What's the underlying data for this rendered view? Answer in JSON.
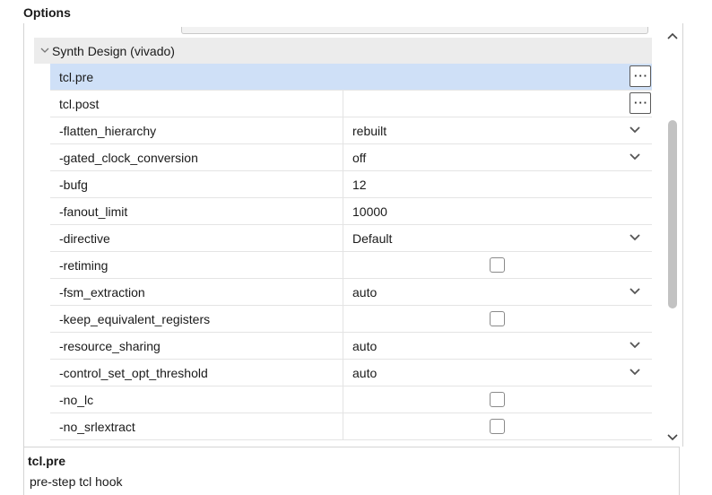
{
  "panel": {
    "title": "Options"
  },
  "group": {
    "label": "Synth Design (vivado)"
  },
  "rows": [
    {
      "name": "tcl.pre",
      "value": "",
      "control": "more",
      "selected": true
    },
    {
      "name": "tcl.post",
      "value": "",
      "control": "more"
    },
    {
      "name": "-flatten_hierarchy",
      "value": "rebuilt",
      "control": "dropdown"
    },
    {
      "name": "-gated_clock_conversion",
      "value": "off",
      "control": "dropdown"
    },
    {
      "name": "-bufg",
      "value": "12",
      "control": "text"
    },
    {
      "name": "-fanout_limit",
      "value": "10000",
      "control": "text"
    },
    {
      "name": "-directive",
      "value": "Default",
      "control": "dropdown"
    },
    {
      "name": "-retiming",
      "value": "",
      "control": "checkbox",
      "checked": false
    },
    {
      "name": "-fsm_extraction",
      "value": "auto",
      "control": "dropdown"
    },
    {
      "name": "-keep_equivalent_registers",
      "value": "",
      "control": "checkbox",
      "checked": false
    },
    {
      "name": "-resource_sharing",
      "value": "auto",
      "control": "dropdown"
    },
    {
      "name": "-control_set_opt_threshold",
      "value": "auto",
      "control": "dropdown"
    },
    {
      "name": "-no_lc",
      "value": "",
      "control": "checkbox",
      "checked": false
    },
    {
      "name": "-no_srlextract",
      "value": "",
      "control": "checkbox",
      "checked": false
    }
  ],
  "more_button": {
    "label": "···"
  },
  "description": {
    "title": "tcl.pre",
    "text": "pre-step tcl hook"
  },
  "icons": {
    "group_toggle": "chevron-down-icon",
    "dropdown": "chevron-down-icon",
    "scroll_up": "chevron-up-icon",
    "scroll_down": "chevron-down-icon"
  },
  "colors": {
    "selection": "#cfe0f7",
    "group_header": "#ececec"
  }
}
